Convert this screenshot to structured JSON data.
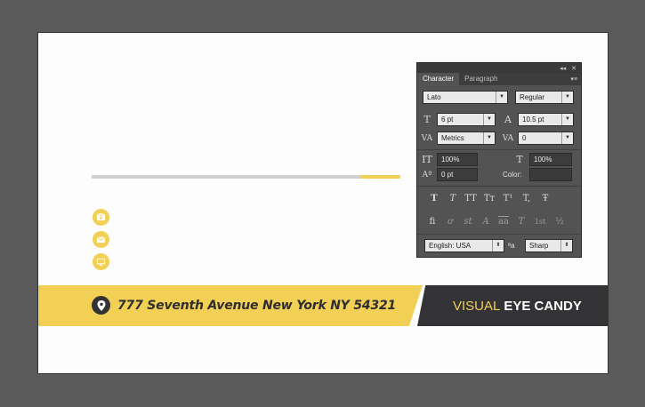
{
  "card": {
    "address": "777 Seventh Avenue New York NY 54321",
    "brand_part1": "VISUAL",
    "brand_part2": "EYE CANDY"
  },
  "contact_icons": [
    "phone-icon",
    "mail-icon",
    "monitor-icon"
  ],
  "panel": {
    "collapse_label": "◂◂",
    "close_label": "✕",
    "menu_label": "▾≡",
    "tabs": [
      {
        "label": "Character",
        "active": true
      },
      {
        "label": "Paragraph",
        "active": false
      }
    ],
    "font_family": "Lato",
    "font_style": "Regular",
    "font_size": "6 pt",
    "leading": "10.5 pt",
    "kerning": "Metrics",
    "tracking": "0",
    "vertical_scale": "100%",
    "horizontal_scale": "100%",
    "baseline_shift": "0 pt",
    "color_label": "Color:",
    "type_styles": [
      "T",
      "T",
      "TT",
      "Tт",
      "T¹",
      "T,",
      "Ŧ"
    ],
    "opentype": [
      "fi",
      "ơ",
      "st",
      "A",
      "aa",
      "T",
      "1st",
      "½"
    ],
    "language": "English: USA",
    "aa_label": "ªa",
    "antialias": "Sharp"
  },
  "colors": {
    "accent_yellow": "#f2cf55",
    "dark": "#333235",
    "panel_bg": "#535353"
  }
}
